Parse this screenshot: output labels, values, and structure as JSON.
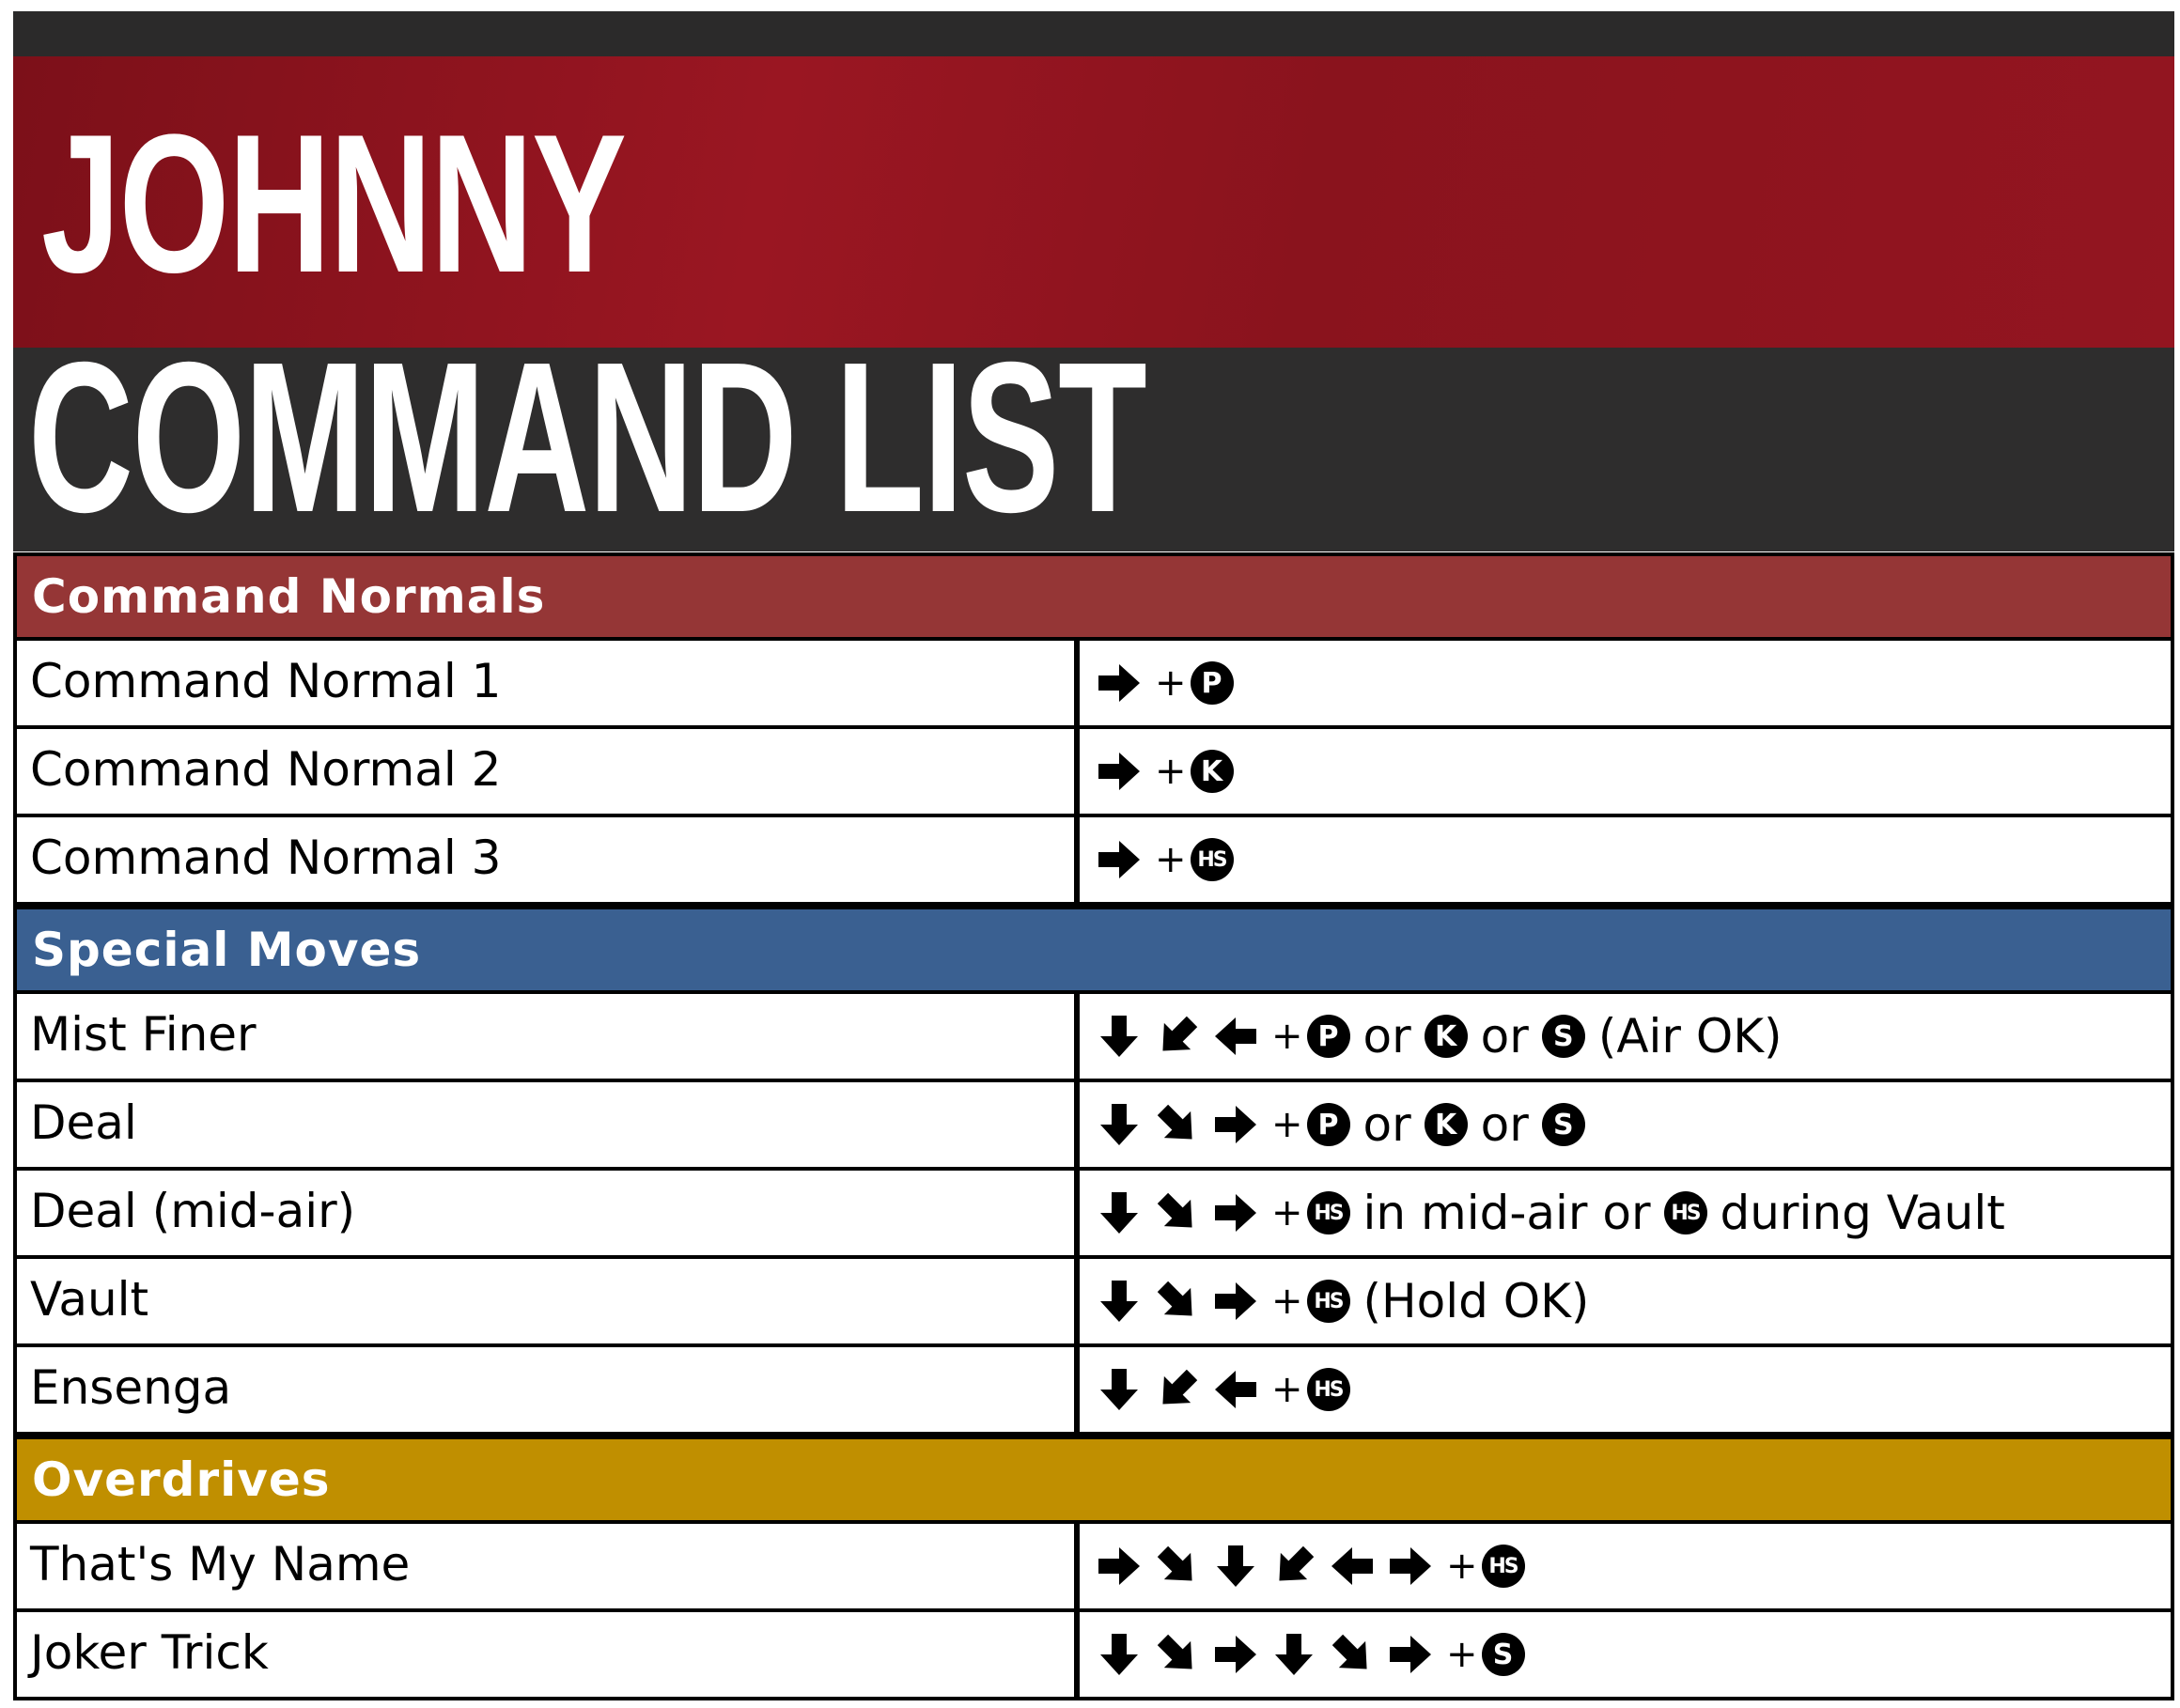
{
  "title": {
    "line1": "JOHNNY",
    "line2": "COMMAND LIST"
  },
  "colors": {
    "command_normals": "#953636",
    "special_moves": "#3a6091",
    "overdrives": "#c08f00",
    "header_red": "#9a1622",
    "header_dark": "#2e2d2d"
  },
  "sections": [
    {
      "label": "Command Normals",
      "moves": [
        {
          "name": "Command Normal 1",
          "input": [
            {
              "a": "right"
            },
            {
              "p": "+"
            },
            {
              "b": "P"
            }
          ]
        },
        {
          "name": "Command Normal 2",
          "input": [
            {
              "a": "right"
            },
            {
              "p": "+"
            },
            {
              "b": "K"
            }
          ]
        },
        {
          "name": "Command Normal 3",
          "input": [
            {
              "a": "right"
            },
            {
              "p": "+"
            },
            {
              "b": "HS"
            }
          ]
        }
      ]
    },
    {
      "label": "Special Moves",
      "moves": [
        {
          "name": "Mist Finer",
          "input": [
            {
              "a": "down"
            },
            {
              "a": "down-left"
            },
            {
              "a": "left"
            },
            {
              "p": "+"
            },
            {
              "b": "P"
            },
            {
              "t": "or"
            },
            {
              "b": "K"
            },
            {
              "t": "or"
            },
            {
              "b": "S"
            },
            {
              "t": "(Air OK)"
            }
          ]
        },
        {
          "name": "Deal",
          "input": [
            {
              "a": "down"
            },
            {
              "a": "down-right"
            },
            {
              "a": "right"
            },
            {
              "p": "+"
            },
            {
              "b": "P"
            },
            {
              "t": "or"
            },
            {
              "b": "K"
            },
            {
              "t": "or"
            },
            {
              "b": "S"
            }
          ]
        },
        {
          "name": "Deal (mid-air)",
          "input": [
            {
              "a": "down"
            },
            {
              "a": "down-right"
            },
            {
              "a": "right"
            },
            {
              "p": "+"
            },
            {
              "b": "HS"
            },
            {
              "t": "in mid-air or"
            },
            {
              "b": "HS"
            },
            {
              "t": "during Vault"
            }
          ]
        },
        {
          "name": "Vault",
          "input": [
            {
              "a": "down"
            },
            {
              "a": "down-right"
            },
            {
              "a": "right"
            },
            {
              "p": "+"
            },
            {
              "b": "HS"
            },
            {
              "t": "(Hold OK)"
            }
          ]
        },
        {
          "name": "Ensenga",
          "input": [
            {
              "a": "down"
            },
            {
              "a": "down-left"
            },
            {
              "a": "left"
            },
            {
              "p": "+"
            },
            {
              "b": "HS"
            }
          ]
        }
      ]
    },
    {
      "label": "Overdrives",
      "moves": [
        {
          "name": "That's My Name",
          "input": [
            {
              "a": "right"
            },
            {
              "a": "down-right"
            },
            {
              "a": "down"
            },
            {
              "a": "down-left"
            },
            {
              "a": "left"
            },
            {
              "a": "right"
            },
            {
              "p": "+"
            },
            {
              "b": "HS"
            }
          ]
        },
        {
          "name": "Joker Trick",
          "input": [
            {
              "a": "down"
            },
            {
              "a": "down-right"
            },
            {
              "a": "right"
            },
            {
              "a": "down"
            },
            {
              "a": "down-right"
            },
            {
              "a": "right"
            },
            {
              "p": "+"
            },
            {
              "b": "S"
            }
          ]
        }
      ]
    }
  ]
}
